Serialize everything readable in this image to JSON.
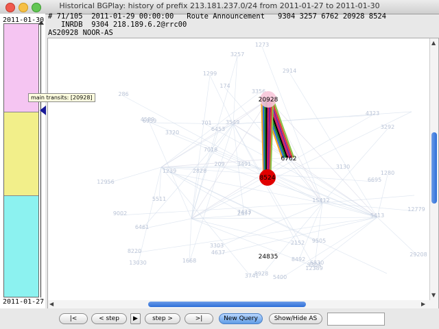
{
  "window": {
    "title": "Historical BGPlay: history of prefix 213.181.237.0/24 from 2011-01-27 to 2011-01-30"
  },
  "timeline": {
    "start_date": "2011-01-30",
    "end_date": "2011-01-27",
    "tooltip": "main transits: [20928]"
  },
  "info": {
    "line1": "# 71/105  2011-01-29 00:00:00   Route Announcement   9304 3257 6762 20928 8524",
    "line2": "   INRDB  9304 218.189.6.2@rrc00"
  },
  "selected_as": "AS20928 NOOR-AS",
  "graph": {
    "nodes": [
      {
        "label": "20928",
        "role": "transit"
      },
      {
        "label": "6762",
        "role": "transit"
      },
      {
        "label": "8524",
        "role": "origin"
      },
      {
        "label": "24835",
        "role": "other"
      }
    ],
    "faded_nodes": [
      "3257",
      "1273",
      "2914",
      "3356",
      "1299",
      "174",
      "701",
      "3549",
      "6453",
      "7018",
      "209",
      "3491",
      "2828",
      "1239",
      "4589",
      "12956",
      "6939",
      "286",
      "3320",
      "5511",
      "6461",
      "9002",
      "8220",
      "13030",
      "1668",
      "3303",
      "4637",
      "7473",
      "2497",
      "8928",
      "5400",
      "3741",
      "9304",
      "12389",
      "15412",
      "9505",
      "2152",
      "8492",
      "6830",
      "3130",
      "4323",
      "3292",
      "1280",
      "6695",
      "5413",
      "12779",
      "29208"
    ],
    "colors": {
      "origin": "#e00000",
      "transit": "#f7c6d9",
      "paths": [
        "#f5a623",
        "#2a6cd8",
        "#1a8a2a",
        "#000000",
        "#d81b60",
        "#7b1fa2",
        "#e53935",
        "#8bc34a"
      ]
    }
  },
  "toolbar": {
    "first": "|<",
    "prev_step": "< step",
    "play": "▶",
    "next_step": "step >",
    "last": ">|",
    "new_query": "New Query",
    "show_hide": "Show/Hide AS",
    "search_value": ""
  }
}
